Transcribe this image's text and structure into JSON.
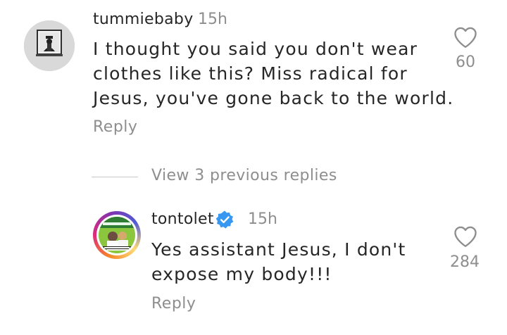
{
  "comments": [
    {
      "username": "tummiebaby",
      "time": "15h",
      "text_lines": [
        "I thought you said you don't wear",
        "clothes like this? Miss radical for",
        "Jesus, you've gone back to the world."
      ],
      "reply_label": "Reply",
      "likes": "60"
    }
  ],
  "view_replies_label": "View 3 previous replies",
  "replies": [
    {
      "username": "tontolet",
      "verified": true,
      "time": "15h",
      "text_lines": [
        "Yes assistant Jesus, I don't",
        "expose my body!!!"
      ],
      "reply_label": "Reply",
      "likes": "284"
    }
  ],
  "colors": {
    "text": "#262626",
    "secondary": "#8e8e8e",
    "verified": "#3897f0"
  },
  "icons": {
    "like": "heart-outline-icon",
    "verified": "verified-badge-icon"
  }
}
